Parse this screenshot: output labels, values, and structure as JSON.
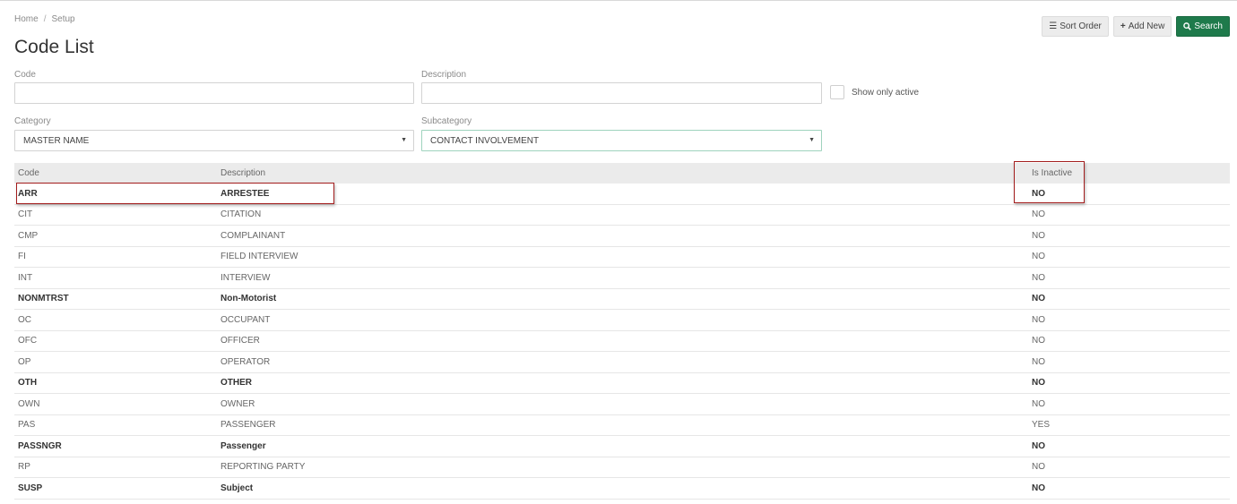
{
  "breadcrumb": {
    "home": "Home",
    "separator": "/",
    "current": "Setup"
  },
  "page_title": "Code List",
  "toolbar": {
    "sort_order": {
      "icon": "list-icon",
      "label": "Sort Order"
    },
    "add_new": {
      "icon": "plus-icon",
      "label": "Add New"
    },
    "search": {
      "icon": "search-icon",
      "label": "Search"
    }
  },
  "filters": {
    "code": {
      "label": "Code",
      "value": ""
    },
    "description": {
      "label": "Description",
      "value": ""
    },
    "show_only_active": {
      "label": "Show only active",
      "checked": false
    },
    "category": {
      "label": "Category",
      "value": "MASTER NAME"
    },
    "subcategory": {
      "label": "Subcategory",
      "value": "CONTACT INVOLVEMENT"
    }
  },
  "table": {
    "headers": {
      "code": "Code",
      "description": "Description",
      "is_inactive": "Is Inactive"
    },
    "rows": [
      {
        "code": "ARR",
        "description": "ARRESTEE",
        "is_inactive": "NO",
        "bold": true
      },
      {
        "code": "CIT",
        "description": "CITATION",
        "is_inactive": "NO",
        "bold": false
      },
      {
        "code": "CMP",
        "description": "COMPLAINANT",
        "is_inactive": "NO",
        "bold": false
      },
      {
        "code": "FI",
        "description": "FIELD INTERVIEW",
        "is_inactive": "NO",
        "bold": false
      },
      {
        "code": "INT",
        "description": "INTERVIEW",
        "is_inactive": "NO",
        "bold": false
      },
      {
        "code": "NONMTRST",
        "description": "Non-Motorist",
        "is_inactive": "NO",
        "bold": true
      },
      {
        "code": "OC",
        "description": "OCCUPANT",
        "is_inactive": "NO",
        "bold": false
      },
      {
        "code": "OFC",
        "description": "OFFICER",
        "is_inactive": "NO",
        "bold": false
      },
      {
        "code": "OP",
        "description": "OPERATOR",
        "is_inactive": "NO",
        "bold": false
      },
      {
        "code": "OTH",
        "description": "OTHER",
        "is_inactive": "NO",
        "bold": true
      },
      {
        "code": "OWN",
        "description": "OWNER",
        "is_inactive": "NO",
        "bold": false
      },
      {
        "code": "PAS",
        "description": "PASSENGER",
        "is_inactive": "YES",
        "bold": false
      },
      {
        "code": "PASSNGR",
        "description": "Passenger",
        "is_inactive": "NO",
        "bold": true
      },
      {
        "code": "RP",
        "description": "REPORTING PARTY",
        "is_inactive": "NO",
        "bold": false
      },
      {
        "code": "SUSP",
        "description": "Subject",
        "is_inactive": "NO",
        "bold": true
      }
    ]
  },
  "colors": {
    "primary": "#1e7a4b",
    "highlight": "#a31d1d",
    "header_bg": "#ebebeb"
  }
}
